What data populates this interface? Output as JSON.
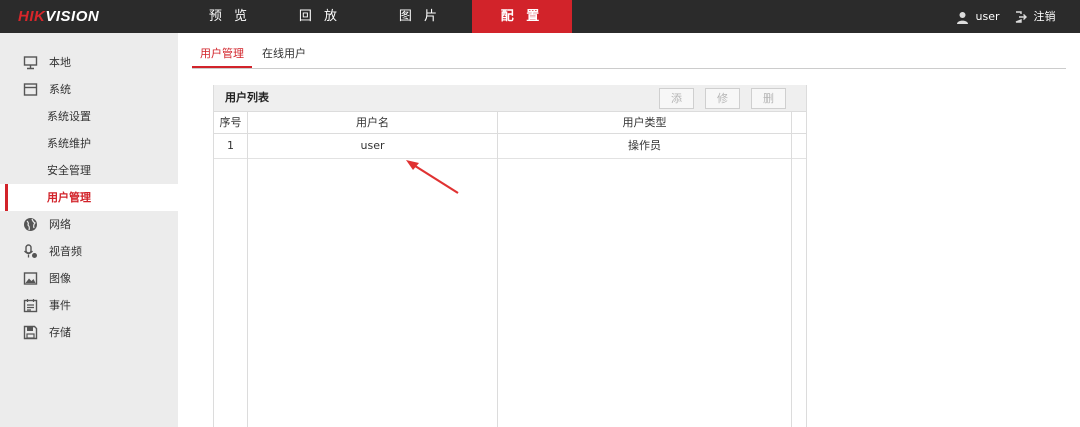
{
  "brand": {
    "logo_red": "HIK",
    "logo_white": "VISION"
  },
  "topnav": {
    "tabs": [
      "预 览",
      "回 放",
      "图 片",
      "配 置"
    ],
    "active_index": 3
  },
  "header": {
    "username": "user",
    "logout_label": "注销"
  },
  "sidebar": {
    "items": [
      {
        "label": "本地",
        "icon": "monitor-icon"
      },
      {
        "label": "系统",
        "icon": "window-icon"
      },
      {
        "label": "系统设置"
      },
      {
        "label": "系统维护"
      },
      {
        "label": "安全管理"
      },
      {
        "label": "用户管理",
        "active": true
      },
      {
        "label": "网络",
        "icon": "globe-icon"
      },
      {
        "label": "视音频",
        "icon": "mic-icon"
      },
      {
        "label": "图像",
        "icon": "image-icon"
      },
      {
        "label": "事件",
        "icon": "calendar-icon"
      },
      {
        "label": "存储",
        "icon": "disk-icon"
      }
    ]
  },
  "subtabs": {
    "items": [
      "用户管理",
      "在线用户"
    ],
    "active_index": 0
  },
  "user_list": {
    "title": "用户列表",
    "buttons": {
      "add": "添加",
      "edit": "修改",
      "delete": "删除"
    },
    "columns": [
      "序号",
      "用户名",
      "用户类型"
    ],
    "rows": [
      {
        "index": "1",
        "username": "user",
        "type": "操作员"
      }
    ]
  },
  "colors": {
    "accent": "#d2232a",
    "topbar": "#2b2b2b",
    "sidebar": "#ececec"
  }
}
